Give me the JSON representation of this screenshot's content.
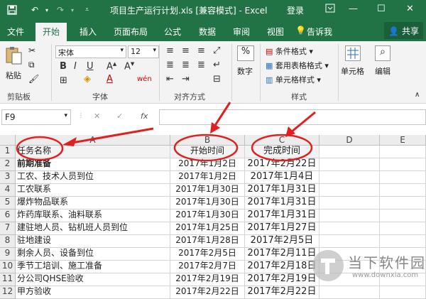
{
  "titlebar": {
    "title": "项目生产运行计划.xls [兼容模式] - Excel",
    "login": "登录",
    "save_icon": "save-icon",
    "undo_icon": "undo-icon",
    "redo_icon": "redo-icon"
  },
  "tabs": [
    "文件",
    "开始",
    "插入",
    "页面布局",
    "公式",
    "数据",
    "审阅",
    "视图"
  ],
  "tell_me": "告诉我",
  "share": "共享",
  "ribbon": {
    "paste": "粘贴",
    "clipboard": "剪贴板",
    "font_name": "宋体",
    "font_size": "12",
    "bold": "B",
    "italic": "I",
    "underline": "U",
    "font_group": "字体",
    "wen": "wén",
    "align_group": "对齐方式",
    "number": "数字",
    "pct": "%",
    "cond_format": "条件格式",
    "table_format": "套用表格格式",
    "cell_style": "单元格样式",
    "styles_group": "样式",
    "cells": "单元格",
    "edit": "编辑"
  },
  "formula_bar": {
    "name_box": "F9",
    "fx": "fx",
    "cancel": "✕",
    "enter": "✓"
  },
  "columns": [
    "A",
    "B",
    "C",
    "D",
    "E"
  ],
  "rows": [
    {
      "n": "1",
      "a": "任务名称",
      "b": "开始时间",
      "c": "完成时间"
    },
    {
      "n": "2",
      "a": "前期准备",
      "b": "2017年1月2日",
      "c": "2017年2月22日"
    },
    {
      "n": "3",
      "a": "工农、技术人员到位",
      "b": "2017年1月2日",
      "c": "2017年1月4日"
    },
    {
      "n": "4",
      "a": "工农联系",
      "b": "2017年1月30日",
      "c": "2017年1月31日"
    },
    {
      "n": "5",
      "a": "爆炸物品联系",
      "b": "2017年1月30日",
      "c": "2017年1月31日"
    },
    {
      "n": "6",
      "a": "炸药库联系、油料联系",
      "b": "2017年1月30日",
      "c": "2017年1月31日"
    },
    {
      "n": "7",
      "a": "建驻地人员、钻机班人员到位",
      "b": "2017年1月25日",
      "c": "2017年1月27日"
    },
    {
      "n": "8",
      "a": "驻地建设",
      "b": "2017年1月28日",
      "c": "2017年2月5日"
    },
    {
      "n": "9",
      "a": "剩余人员、设备到位",
      "b": "2017年2月5日",
      "c": "2017年2月11日"
    },
    {
      "n": "10",
      "a": "季节工培训、施工准备",
      "b": "2017年2月7日",
      "c": "2017年2月18日"
    },
    {
      "n": "11",
      "a": "分公司QHSE验收",
      "b": "2017年2月19日",
      "c": "2017年2月19日"
    },
    {
      "n": "12",
      "a": "甲方验收",
      "b": "2017年2月22日",
      "c": "2017年2月22日"
    }
  ],
  "watermark": {
    "text": "当下软件园",
    "url": "www.downxia.com"
  },
  "colors": {
    "excel_green": "#217346",
    "annotation_red": "#e02020"
  }
}
